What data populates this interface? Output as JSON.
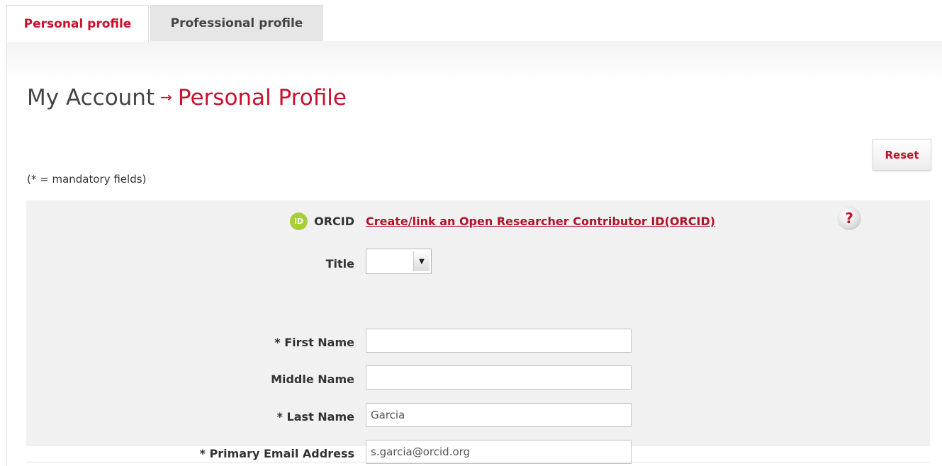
{
  "tabs": [
    {
      "label": "Personal profile",
      "active": true
    },
    {
      "label": "Professional profile",
      "active": false
    }
  ],
  "breadcrumb": {
    "root": "My Account",
    "arrow": "→",
    "current": "Personal Profile"
  },
  "reset_label": "Reset",
  "mandatory_note": "(* = mandatory fields)",
  "orcid": {
    "icon": "orcid-logo-icon",
    "badge_text": "iD",
    "label": "ORCID",
    "link_text": "Create/link an Open Researcher Contributor ID(ORCID)",
    "help_glyph": "?"
  },
  "form": {
    "title": {
      "label": "Title",
      "value": "",
      "options_arrow": "▼"
    },
    "first_name": {
      "label": "* First Name",
      "value": ""
    },
    "middle_name": {
      "label": "Middle Name",
      "value": ""
    },
    "last_name": {
      "label": "* Last Name",
      "value": "Garcia"
    },
    "email": {
      "label": "* Primary Email Address",
      "value": "s.garcia@orcid.org"
    }
  },
  "colors": {
    "accent": "#c8102e",
    "link": "#b01229",
    "orcid_green": "#a6ce39",
    "form_background": "#f1f1f1"
  }
}
